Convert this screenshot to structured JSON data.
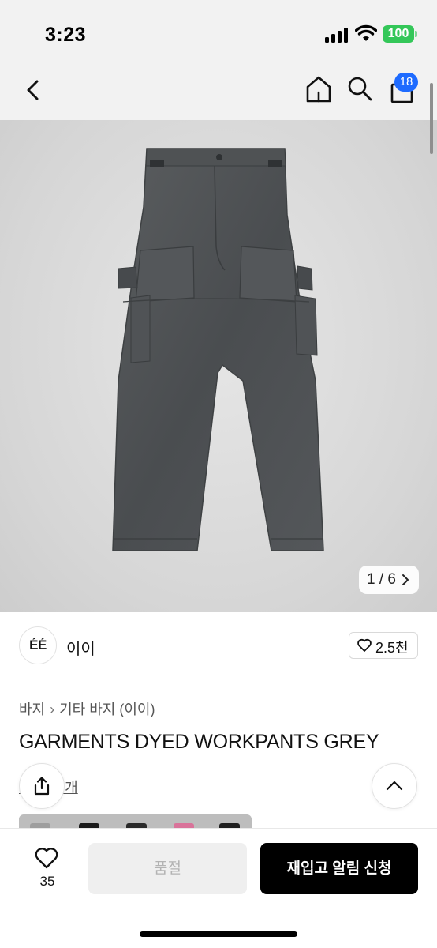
{
  "status_bar": {
    "time": "3:23",
    "battery": "100"
  },
  "nav": {
    "cart_badge": "18"
  },
  "gallery": {
    "counter": "1 / 6"
  },
  "brand": {
    "logo_text": "ÉÉ",
    "name": "이이",
    "like_count": "2.5천"
  },
  "breadcrumb": [
    "바지",
    "기타 바지 (이이)"
  ],
  "product": {
    "title": "GARMENTS DYED WORKPANTS GREY",
    "reviews_link": "후기 13개"
  },
  "bottom_bar": {
    "wishlist_count": "35",
    "soldout_label": "품절",
    "restock_label": "재입고 알림 신청"
  },
  "colors": {
    "accent": "#1e6bff",
    "battery": "#34c759",
    "primary_button": "#000000",
    "disabled_button": "#efefef"
  },
  "icons": {
    "back": "chevron-left-icon",
    "home": "home-icon",
    "search": "search-icon",
    "cart": "bag-icon",
    "like": "heart-icon",
    "share": "share-icon",
    "scroll_top": "chevron-up-icon"
  }
}
